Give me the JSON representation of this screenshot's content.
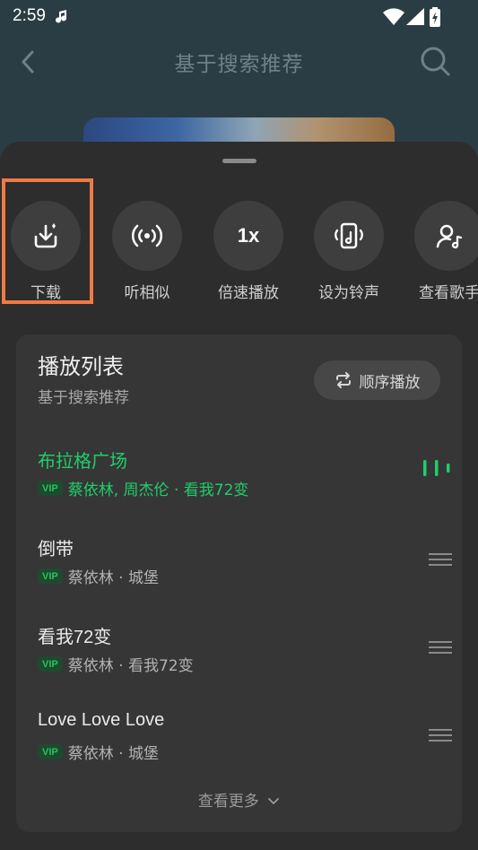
{
  "status": {
    "time": "2:59"
  },
  "header": {
    "title": "基于搜索推荐"
  },
  "actions": [
    {
      "label": "下载",
      "icon": "download-icon"
    },
    {
      "label": "听相似",
      "icon": "broadcast-icon"
    },
    {
      "label": "倍速播放",
      "icon": "speed-icon",
      "text": "1x"
    },
    {
      "label": "设为铃声",
      "icon": "ringtone-icon"
    },
    {
      "label": "查看歌手",
      "icon": "singer-icon"
    }
  ],
  "playlist": {
    "title": "播放列表",
    "subtitle": "基于搜索推荐",
    "order_label": "顺序播放",
    "more_label": "查看更多",
    "vip_badge": "VIP",
    "tracks": [
      {
        "title": "布拉格广场",
        "meta": "蔡依林, 周杰伦 · 看我72变",
        "playing": true
      },
      {
        "title": "倒带",
        "meta": "蔡依林 · 城堡"
      },
      {
        "title": "看我72变",
        "meta": "蔡依林 · 看我72变"
      },
      {
        "title": "Love Love Love",
        "meta": "蔡依林 · 城堡"
      }
    ]
  },
  "colors": {
    "accent": "#1fce6a",
    "highlight": "#ef7a45",
    "sheet": "#2d2d2d"
  }
}
